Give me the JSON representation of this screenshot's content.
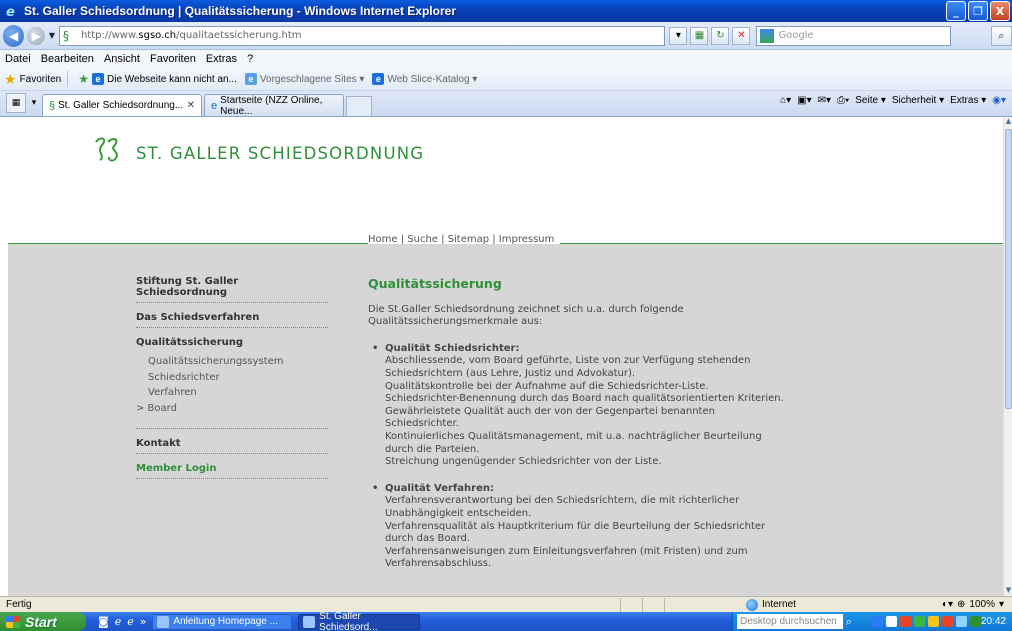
{
  "window": {
    "title": "St. Galler Schiedsordnung | Qualitätssicherung - Windows Internet Explorer",
    "buttons": [
      "_",
      "❐",
      "X"
    ]
  },
  "address": {
    "url_prefix": "http://www.",
    "url_host": "sgso.ch",
    "url_path": "/qualitaetssicherung.htm",
    "search_placeholder": "Google"
  },
  "menu": [
    "Datei",
    "Bearbeiten",
    "Ansicht",
    "Favoriten",
    "Extras",
    "?"
  ],
  "favorites": {
    "label": "Favoriten",
    "items": [
      {
        "label": "Die Webseite kann nicht an...",
        "grey": false
      },
      {
        "label": "Vorgeschlagene Sites ▾",
        "grey": true
      },
      {
        "label": "Web Slice-Katalog ▾",
        "grey": true
      }
    ]
  },
  "tabs": [
    {
      "label": "St. Galler Schiedsordnung...",
      "active": true
    },
    {
      "label": "Startseite (NZZ Online, Neue...",
      "active": false
    }
  ],
  "tools": {
    "page": "Seite ▾",
    "security": "Sicherheit ▾",
    "extras": "Extras ▾"
  },
  "site": {
    "logo_mark": "SG",
    "name": "ST. GALLER SCHIEDSORDNUNG",
    "toplinks": "Home | Suche | Sitemap | Impressum"
  },
  "nav": {
    "section1": "Stiftung St. Galler Schiedsordnung",
    "section2": "Das Schiedsverfahren",
    "section3": "Qualitätssicherung",
    "sub": [
      "Qualitätssicherungssystem",
      "Schiedsrichter",
      "Verfahren",
      "> Board"
    ],
    "section4": "Kontakt",
    "section5": "Member Login"
  },
  "content": {
    "heading": "Qualitätssicherung",
    "intro": "Die St.Galler Schiedsordnung zeichnet sich u.a. durch folgende Qualitätssicherungsmerkmale aus:",
    "items": [
      {
        "head": "Qualität Schiedsrichter:",
        "lines": [
          "Abschliessende, vom Board geführte, Liste von zur Verfügung stehenden Schiedsrichtern (aus Lehre, Justiz und Advokatur).",
          "Qualitätskontrolle bei der Aufnahme auf die Schiedsrichter-Liste.",
          "Schiedsrichter-Benennung durch das Board nach qualitätsorientierten Kriterien.",
          "Gewährleistete Qualität auch der von der Gegenpartei benannten Schiedsrichter.",
          "Kontinuierliches Qualitätsmanagement, mit u.a. nachträglicher Beurteilung durch die Parteien.",
          "Streichung ungenügender Schiedsrichter von der Liste."
        ]
      },
      {
        "head": "Qualität Verfahren:",
        "lines": [
          "Verfahrensverantwortung bei den Schiedsrichtern, die mit richterlicher Unabhängigkeit entscheiden.",
          "Verfahrensqualität als Hauptkriterium für die Beurteilung der Schiedsrichter durch das Board.",
          "Verfahrensanweisungen zum Einleitungsverfahren (mit Fristen) und zum Verfahrensabschluss."
        ]
      }
    ]
  },
  "status": {
    "text": "Fertig",
    "zone": "Internet",
    "zoom": "100%"
  },
  "taskbar": {
    "start": "Start",
    "task1": "Anleitung Homepage ...",
    "task2": "St. Galler Schiedsord...",
    "desktop_search": "Desktop durchsuchen",
    "time": "20:42"
  },
  "colors": {
    "brand_green": "#2f8f3a",
    "nav_gray": "#d6d6d6"
  }
}
